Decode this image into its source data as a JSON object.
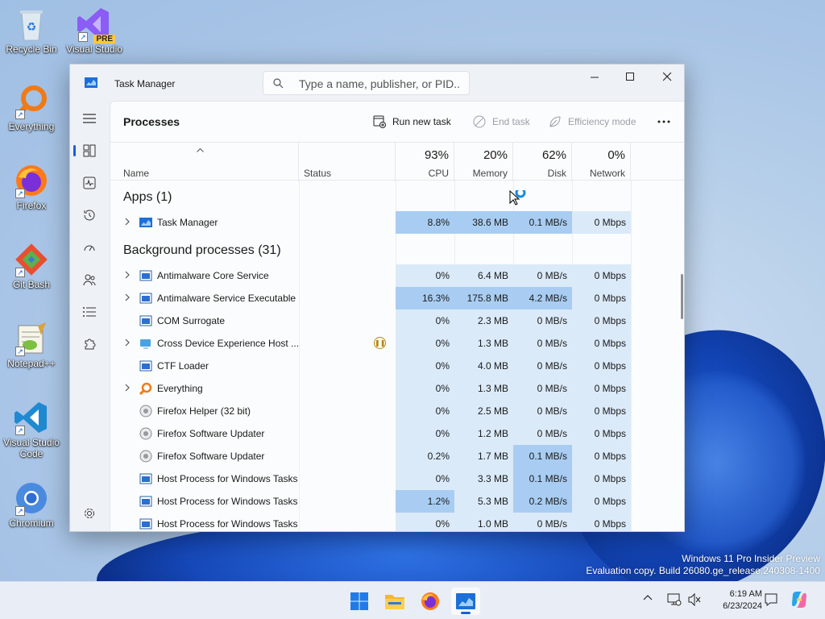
{
  "desktop": {
    "icons": [
      {
        "label": "Recycle Bin",
        "icon": "recycle-bin-icon"
      },
      {
        "label": "Visual Studio 2022 P...",
        "icon": "visual-studio-preview-icon",
        "badge": "PRE"
      },
      {
        "label": "Everything",
        "icon": "everything-icon"
      },
      {
        "label": "Firefox",
        "icon": "firefox-icon"
      },
      {
        "label": "Git Bash",
        "icon": "git-bash-icon"
      },
      {
        "label": "Notepad++",
        "icon": "notepad-plus-plus-icon"
      },
      {
        "label": "Visual Studio Code",
        "icon": "vscode-icon"
      },
      {
        "label": "Chromium",
        "icon": "chromium-icon"
      }
    ],
    "watermark": {
      "line1": "Windows 11 Pro Insider Preview",
      "line2": "Evaluation copy. Build 26080.ge_release.240308-1400"
    }
  },
  "window": {
    "title": "Task Manager",
    "search_placeholder": "Type a name, publisher, or PID...",
    "page_title": "Processes",
    "toolbar": {
      "run_new_task": "Run new task",
      "end_task": "End task",
      "efficiency_mode": "Efficiency mode"
    },
    "columns": {
      "name": "Name",
      "status": "Status",
      "cpu": {
        "pct": "93%",
        "label": "CPU"
      },
      "memory": {
        "pct": "20%",
        "label": "Memory"
      },
      "disk": {
        "pct": "62%",
        "label": "Disk"
      },
      "network": {
        "pct": "0%",
        "label": "Network"
      }
    },
    "groups": {
      "apps": "Apps (1)",
      "background": "Background processes (31)"
    },
    "apps": [
      {
        "name": "Task Manager",
        "cpu": "8.8%",
        "memory": "38.6 MB",
        "disk": "0.1 MB/s",
        "network": "0 Mbps",
        "expandable": true
      }
    ],
    "background": [
      {
        "name": "Antimalware Core Service",
        "cpu": "0%",
        "memory": "6.4 MB",
        "disk": "0 MB/s",
        "network": "0 Mbps",
        "expandable": true
      },
      {
        "name": "Antimalware Service Executable",
        "cpu": "16.3%",
        "memory": "175.8 MB",
        "disk": "4.2 MB/s",
        "network": "0 Mbps",
        "expandable": true
      },
      {
        "name": "COM Surrogate",
        "cpu": "0%",
        "memory": "2.3 MB",
        "disk": "0 MB/s",
        "network": "0 Mbps",
        "expandable": false
      },
      {
        "name": "Cross Device Experience Host ...",
        "cpu": "0%",
        "memory": "1.3 MB",
        "disk": "0 MB/s",
        "network": "0 Mbps",
        "expandable": true,
        "suspended": true
      },
      {
        "name": "CTF Loader",
        "cpu": "0%",
        "memory": "4.0 MB",
        "disk": "0 MB/s",
        "network": "0 Mbps",
        "expandable": false
      },
      {
        "name": "Everything",
        "cpu": "0%",
        "memory": "1.3 MB",
        "disk": "0 MB/s",
        "network": "0 Mbps",
        "expandable": true
      },
      {
        "name": "Firefox Helper (32 bit)",
        "cpu": "0%",
        "memory": "2.5 MB",
        "disk": "0 MB/s",
        "network": "0 Mbps",
        "expandable": false
      },
      {
        "name": "Firefox Software Updater",
        "cpu": "0%",
        "memory": "1.2 MB",
        "disk": "0 MB/s",
        "network": "0 Mbps",
        "expandable": false
      },
      {
        "name": "Firefox Software Updater",
        "cpu": "0.2%",
        "memory": "1.7 MB",
        "disk": "0.1 MB/s",
        "network": "0 Mbps",
        "expandable": false
      },
      {
        "name": "Host Process for Windows Tasks",
        "cpu": "0%",
        "memory": "3.3 MB",
        "disk": "0.1 MB/s",
        "network": "0 Mbps",
        "expandable": false
      },
      {
        "name": "Host Process for Windows Tasks",
        "cpu": "1.2%",
        "memory": "5.3 MB",
        "disk": "0.2 MB/s",
        "network": "0 Mbps",
        "expandable": false
      },
      {
        "name": "Host Process for Windows Tasks",
        "cpu": "0%",
        "memory": "1.0 MB",
        "disk": "0 MB/s",
        "network": "0 Mbps",
        "expandable": false
      }
    ]
  },
  "taskbar": {
    "time": "6:19 AM",
    "date": "6/23/2024"
  },
  "colors": {
    "accent": "#1a5fd0",
    "heat_low": "#dbeaf9",
    "heat_mid": "#c4dcf5",
    "heat_high": "#a9cdf2"
  }
}
